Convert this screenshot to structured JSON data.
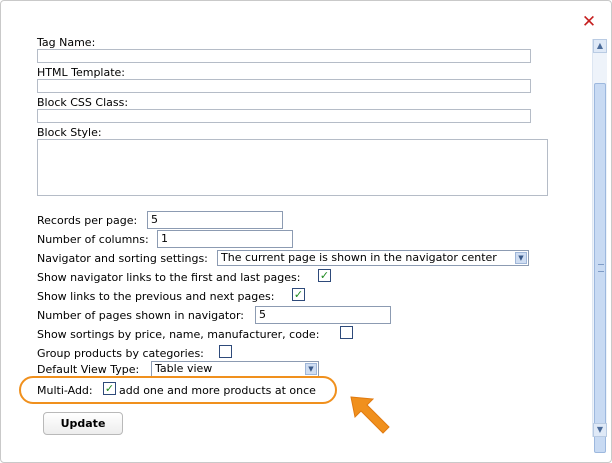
{
  "dialog": {
    "close_icon": "close-icon",
    "accent": "#f0901d"
  },
  "fields": {
    "tag_name_label": "Tag Name:",
    "html_template_label": "HTML Template:",
    "block_css_class_label": "Block CSS Class:",
    "block_style_label": "Block Style:",
    "records_per_page_label": "Records per page:",
    "records_per_page_value": "5",
    "number_of_columns_label": "Number of columns:",
    "number_of_columns_value": "1",
    "nav_sorting_label": "Navigator and sorting settings:",
    "nav_sorting_value": "The current page is shown in the navigator center",
    "show_first_last_label": "Show navigator links to the first and last pages:",
    "show_first_last_checked": true,
    "show_prev_next_label": "Show links to the previous and next pages:",
    "show_prev_next_checked": true,
    "pages_in_navigator_label": "Number of pages shown in navigator:",
    "pages_in_navigator_value": "5",
    "show_sortings_label": "Show sortings by price, name, manufacturer, code:",
    "show_sortings_checked": false,
    "group_by_categories_label": "Group products by categories:",
    "group_by_categories_checked": false,
    "default_view_label": "Default View Type:",
    "default_view_value": "Table view",
    "multi_add_label": "Multi-Add:",
    "multi_add_checked": true,
    "multi_add_text": "add one and more products at once"
  },
  "buttons": {
    "update_label": "Update"
  }
}
